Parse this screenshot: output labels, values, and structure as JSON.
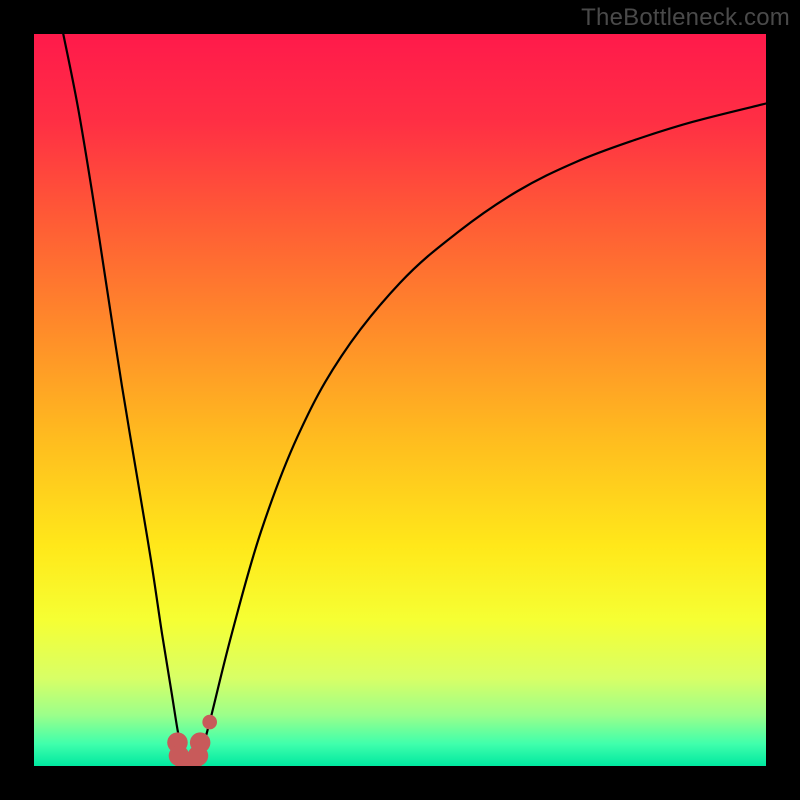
{
  "watermark": {
    "text": "TheBottleneck.com"
  },
  "gradient": {
    "stops": [
      {
        "pct": 0,
        "color": "#ff1a4b"
      },
      {
        "pct": 12,
        "color": "#ff2f44"
      },
      {
        "pct": 25,
        "color": "#ff5a36"
      },
      {
        "pct": 40,
        "color": "#ff8a2a"
      },
      {
        "pct": 55,
        "color": "#ffbb1f"
      },
      {
        "pct": 70,
        "color": "#ffe81a"
      },
      {
        "pct": 80,
        "color": "#f6ff33"
      },
      {
        "pct": 88,
        "color": "#d8ff66"
      },
      {
        "pct": 93,
        "color": "#9cff8a"
      },
      {
        "pct": 97,
        "color": "#3fffac"
      },
      {
        "pct": 100,
        "color": "#00e8a0"
      }
    ]
  },
  "chart_data": {
    "type": "line",
    "title": "",
    "xlabel": "",
    "ylabel": "",
    "xlim": [
      0,
      100
    ],
    "ylim": [
      0,
      100
    ],
    "series": [
      {
        "name": "left-falling-curve",
        "x": [
          4.0,
          6.0,
          8.0,
          10.0,
          12.0,
          14.0,
          16.0,
          17.5,
          18.8,
          19.6,
          20.2,
          20.6
        ],
        "y": [
          100.0,
          90.0,
          78.0,
          65.0,
          52.0,
          40.0,
          28.0,
          18.0,
          10.0,
          5.0,
          2.0,
          0.5
        ]
      },
      {
        "name": "right-rising-curve",
        "x": [
          22.5,
          24.0,
          27.0,
          31.0,
          36.0,
          42.0,
          50.0,
          58.0,
          66.0,
          74.0,
          82.0,
          90.0,
          100.0
        ],
        "y": [
          0.5,
          6.0,
          18.0,
          32.0,
          45.0,
          56.0,
          66.0,
          73.0,
          78.5,
          82.5,
          85.5,
          88.0,
          90.5
        ]
      }
    ],
    "markers": {
      "name": "valley-markers",
      "color": "#c85a5a",
      "points": [
        {
          "x": 19.6,
          "y": 3.2,
          "r": 1.4
        },
        {
          "x": 19.8,
          "y": 1.4,
          "r": 1.4
        },
        {
          "x": 20.6,
          "y": 0.6,
          "r": 1.4
        },
        {
          "x": 21.6,
          "y": 0.6,
          "r": 1.4
        },
        {
          "x": 22.4,
          "y": 1.4,
          "r": 1.4
        },
        {
          "x": 22.7,
          "y": 3.2,
          "r": 1.4
        },
        {
          "x": 24.0,
          "y": 6.0,
          "r": 1.0
        }
      ]
    }
  }
}
